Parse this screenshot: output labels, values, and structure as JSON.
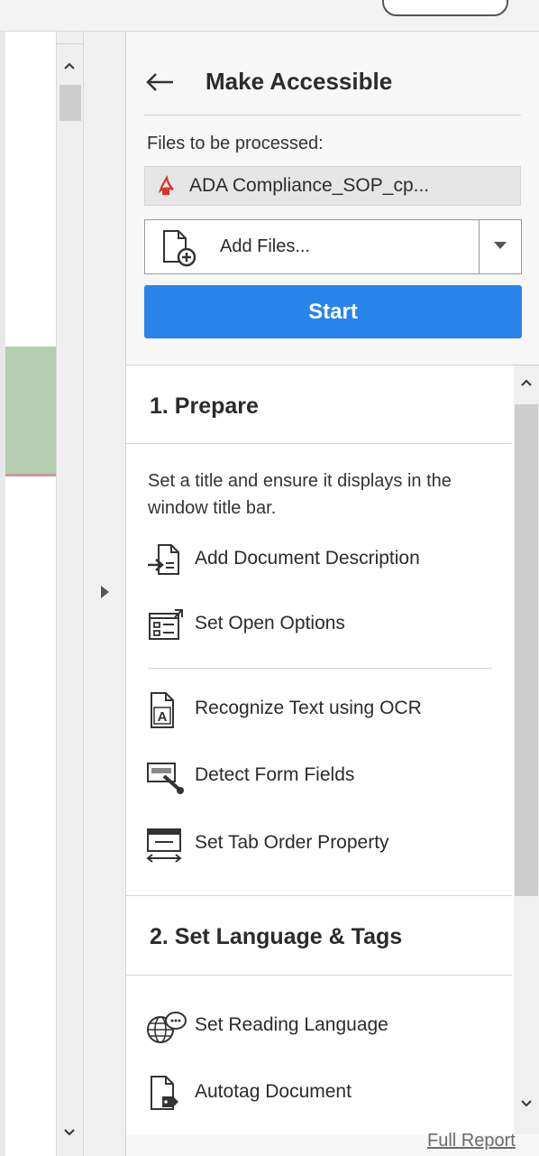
{
  "panel": {
    "title": "Make Accessible",
    "files_label": "Files to be processed:",
    "file_name": "ADA Compliance_SOP_cp...",
    "add_files_label": "Add Files...",
    "start_label": "Start"
  },
  "sections": {
    "prepare": {
      "heading": "1. Prepare",
      "description": "Set a title and ensure it displays in the window title bar.",
      "items": [
        {
          "label": "Add Document Description",
          "icon": "document-description-icon"
        },
        {
          "label": "Set Open Options",
          "icon": "open-options-icon"
        },
        {
          "label": "Recognize Text using OCR",
          "icon": "ocr-icon"
        },
        {
          "label": "Detect Form Fields",
          "icon": "form-fields-icon"
        },
        {
          "label": "Set Tab Order Property",
          "icon": "tab-order-icon"
        }
      ]
    },
    "language_tags": {
      "heading": "2. Set Language & Tags",
      "items": [
        {
          "label": "Set Reading Language",
          "icon": "reading-language-icon"
        },
        {
          "label": "Autotag Document",
          "icon": "autotag-icon"
        }
      ]
    }
  },
  "footer": {
    "full_report": "Full Report"
  },
  "colors": {
    "start_button": "#2a83e8",
    "pdf_red": "#d9342b"
  }
}
